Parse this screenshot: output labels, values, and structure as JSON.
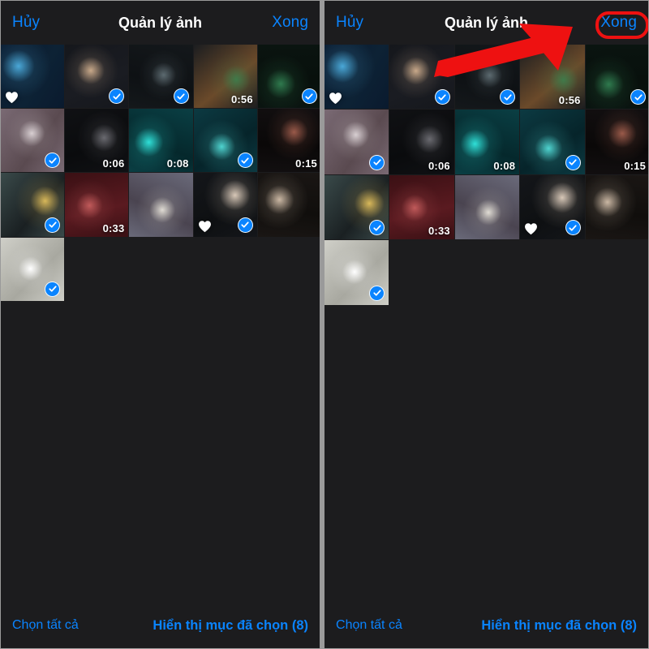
{
  "app": {
    "title": "Quản lý ảnh",
    "accent_blue": "#0a84ff",
    "background": "#1c1c1e",
    "annotation_red": "#ee1111"
  },
  "navbar": {
    "cancel_label": "Hủy",
    "title": "Quản lý ảnh",
    "done_label": "Xong"
  },
  "toolbar": {
    "select_all_label": "Chọn tất cả",
    "show_selected_label": "Hiển thị mục đã chọn (8)",
    "selected_count": 8
  },
  "grid": {
    "columns": 5,
    "items": [
      {
        "id": 1,
        "scene": "blue-dress-performer",
        "selected": false,
        "favorite": true,
        "duration": null,
        "c1": "#0a1a2e",
        "c2": "#4aa8d8",
        "c3": "#0d2235"
      },
      {
        "id": 2,
        "scene": "singer-with-mic",
        "selected": true,
        "favorite": false,
        "duration": null,
        "c1": "#15171c",
        "c2": "#c9a98a",
        "c3": "#1a1c22"
      },
      {
        "id": 3,
        "scene": "guitarist-stage",
        "selected": true,
        "favorite": false,
        "duration": null,
        "c1": "#14181b",
        "c2": "#5c6a70",
        "c3": "#0e1114"
      },
      {
        "id": 4,
        "scene": "green-shirt-guitarist",
        "selected": false,
        "favorite": false,
        "duration": "0:56",
        "c1": "#1b1d20",
        "c2": "#3f7a4a",
        "c3": "#6b4a2a"
      },
      {
        "id": 5,
        "scene": "green-light-performer",
        "selected": true,
        "favorite": false,
        "duration": null,
        "c1": "#0a1410",
        "c2": "#2f7a4e",
        "c3": "#08100c"
      },
      {
        "id": 6,
        "scene": "couple-dancing",
        "selected": true,
        "favorite": false,
        "duration": null,
        "c1": "#7a6a74",
        "c2": "#d8cfd2",
        "c3": "#5a4a50"
      },
      {
        "id": 7,
        "scene": "dark-hall-screen",
        "selected": false,
        "favorite": false,
        "duration": "0:06",
        "c1": "#101114",
        "c2": "#6a6a70",
        "c3": "#0a0b0d"
      },
      {
        "id": 8,
        "scene": "teal-crowd-performer",
        "selected": false,
        "favorite": false,
        "duration": "0:08",
        "c1": "#0a3f44",
        "c2": "#2fe0d8",
        "c3": "#05282c"
      },
      {
        "id": 9,
        "scene": "teal-guitar-crowd",
        "selected": true,
        "favorite": false,
        "duration": null,
        "c1": "#0c3a42",
        "c2": "#4fd4d0",
        "c3": "#06242a"
      },
      {
        "id": 10,
        "scene": "empty-stage-wide",
        "selected": false,
        "favorite": false,
        "duration": "0:15",
        "c1": "#120f10",
        "c2": "#9a5a4a",
        "c3": "#0a0808"
      },
      {
        "id": 11,
        "scene": "singer-yellow-jacket",
        "selected": true,
        "favorite": false,
        "duration": null,
        "c1": "#3a4a4a",
        "c2": "#d8b85a",
        "c3": "#1a2022"
      },
      {
        "id": 12,
        "scene": "solo-on-red-stage",
        "selected": false,
        "favorite": false,
        "duration": "0:33",
        "c1": "#3a1014",
        "c2": "#c05a5a",
        "c3": "#5a1a20"
      },
      {
        "id": 13,
        "scene": "couple-bouquet-stage",
        "selected": false,
        "favorite": false,
        "duration": null,
        "c1": "#6a6a7a",
        "c2": "#e0dcd4",
        "c3": "#4a4450"
      },
      {
        "id": 14,
        "scene": "two-friends-selfie",
        "selected": true,
        "favorite": true,
        "duration": null,
        "c1": "#14161a",
        "c2": "#d8c8b8",
        "c3": "#0e1012"
      },
      {
        "id": 15,
        "scene": "two-friends-selfie-dark",
        "selected": false,
        "favorite": false,
        "duration": null,
        "c1": "#1a1614",
        "c2": "#cbb8a4",
        "c3": "#100e0c"
      },
      {
        "id": 16,
        "scene": "two-in-white-indoors",
        "selected": true,
        "favorite": false,
        "duration": null,
        "c1": "#cfcfc8",
        "c2": "#ffffff",
        "c3": "#a8a8a0"
      }
    ]
  },
  "annotations": {
    "done_highlight": {
      "target": "done-button",
      "shape": "rounded-rect",
      "color": "#ee1111"
    },
    "pointer_arrow": {
      "target": "done-button",
      "shape": "arrow",
      "color": "#ee1111",
      "direction": "up-right"
    }
  }
}
